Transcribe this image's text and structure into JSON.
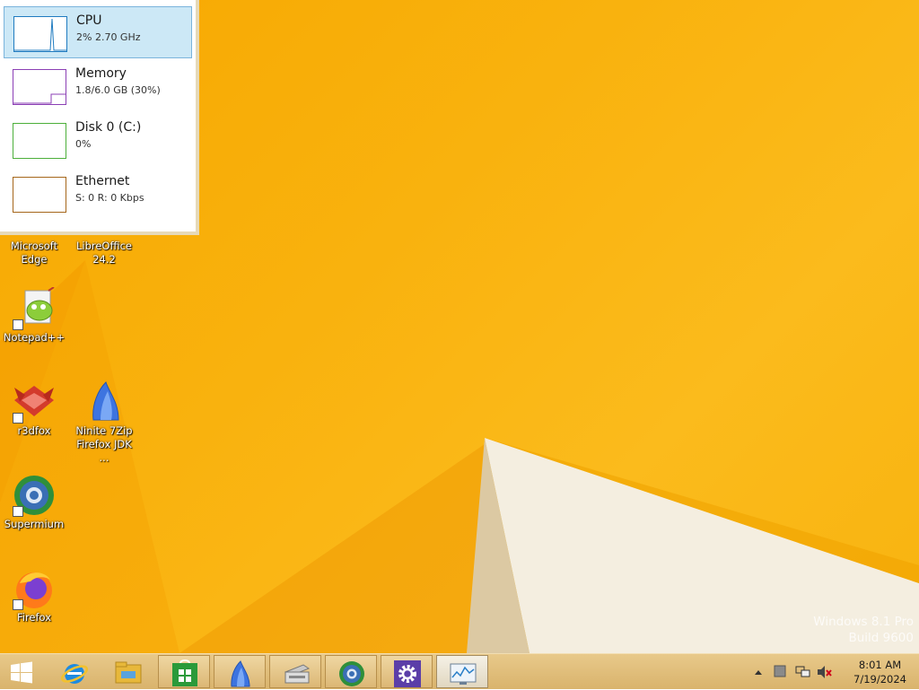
{
  "perf_panel": {
    "items": [
      {
        "title": "CPU",
        "sub": "2% 2.70 GHz"
      },
      {
        "title": "Memory",
        "sub": "1.8/6.0 GB (30%)"
      },
      {
        "title": "Disk 0 (C:)",
        "sub": "0%"
      },
      {
        "title": "Ethernet",
        "sub": "S: 0 R: 0 Kbps"
      }
    ],
    "colors": {
      "cpu": "#1f7bc0",
      "memory": "#8b3fb5",
      "disk": "#4caf3a",
      "ethernet": "#a5661a"
    }
  },
  "desktop_icons": [
    {
      "label_lines": [
        "Microsoft",
        "Edge"
      ]
    },
    {
      "label_lines": [
        "LibreOffice",
        "24.2"
      ]
    },
    {
      "label_lines": [
        "Notepad++"
      ]
    },
    {
      "label_lines": [
        "r3dfox"
      ]
    },
    {
      "label_lines": [
        "Ninite 7Zip",
        "Firefox JDK ..."
      ]
    },
    {
      "label_lines": [
        "Supermium"
      ]
    },
    {
      "label_lines": [
        "Firefox"
      ]
    }
  ],
  "watermark": {
    "line1": "Windows 8.1 Pro",
    "line2": "Build 9600"
  },
  "taskbar": {
    "buttons": [
      "start-icon",
      "internet-explorer-icon",
      "file-explorer-icon",
      "store-icon",
      "ninite-icon",
      "scanner-icon",
      "supermium-icon",
      "settings-icon",
      "task-manager-icon"
    ],
    "tray_icons": [
      "show-hidden-icons-icon",
      "action-center-icon",
      "network-icon",
      "volume-muted-icon"
    ]
  },
  "clock": {
    "time": "8:01 AM",
    "date": "7/19/2024"
  }
}
